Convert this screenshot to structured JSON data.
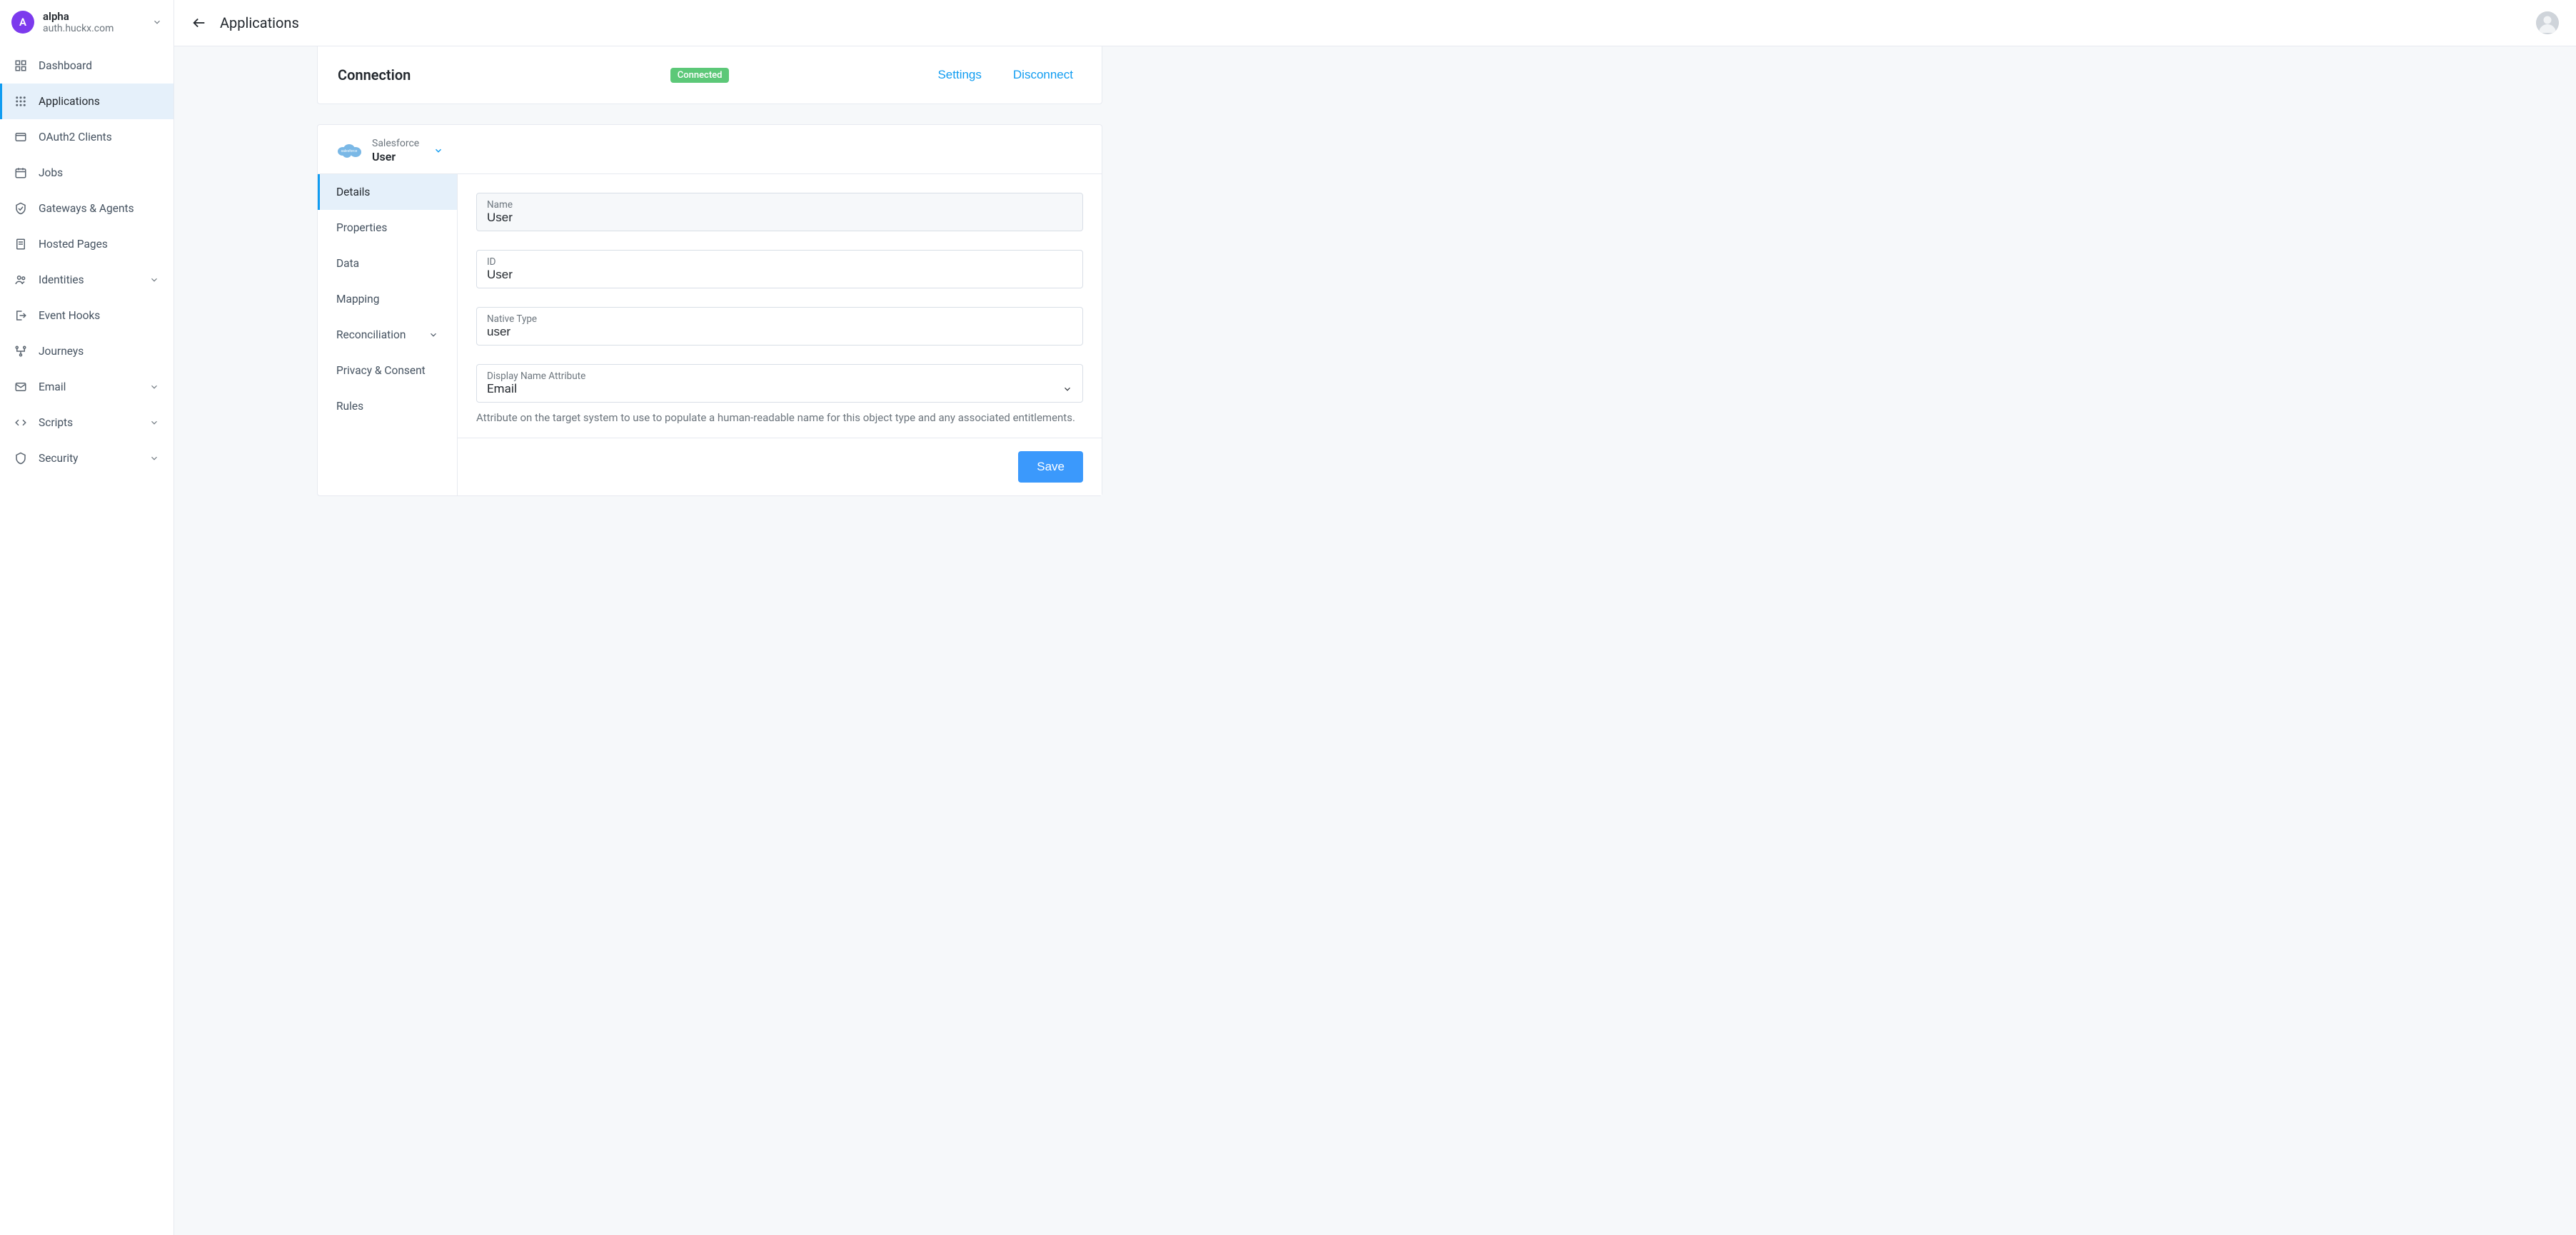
{
  "tenant": {
    "initial": "A",
    "name": "alpha",
    "domain": "auth.huckx.com"
  },
  "sidebar": {
    "items": [
      {
        "label": "Dashboard",
        "icon": "dashboard",
        "expandable": false,
        "active": false
      },
      {
        "label": "Applications",
        "icon": "apps",
        "expandable": false,
        "active": true
      },
      {
        "label": "OAuth2 Clients",
        "icon": "browser",
        "expandable": false,
        "active": false
      },
      {
        "label": "Jobs",
        "icon": "calendar",
        "expandable": false,
        "active": false
      },
      {
        "label": "Gateways & Agents",
        "icon": "shield-check",
        "expandable": false,
        "active": false
      },
      {
        "label": "Hosted Pages",
        "icon": "page",
        "expandable": false,
        "active": false
      },
      {
        "label": "Identities",
        "icon": "people",
        "expandable": true,
        "active": false
      },
      {
        "label": "Event Hooks",
        "icon": "exit",
        "expandable": false,
        "active": false
      },
      {
        "label": "Journeys",
        "icon": "route",
        "expandable": false,
        "active": false
      },
      {
        "label": "Email",
        "icon": "mail",
        "expandable": true,
        "active": false
      },
      {
        "label": "Scripts",
        "icon": "code",
        "expandable": true,
        "active": false
      },
      {
        "label": "Security",
        "icon": "shield",
        "expandable": true,
        "active": false
      }
    ]
  },
  "header": {
    "title": "Applications"
  },
  "connection": {
    "title": "Connection",
    "status": "Connected",
    "settings_label": "Settings",
    "disconnect_label": "Disconnect"
  },
  "object": {
    "provider": "Salesforce",
    "name": "User"
  },
  "tabs": [
    {
      "label": "Details",
      "expandable": false,
      "active": true
    },
    {
      "label": "Properties",
      "expandable": false,
      "active": false
    },
    {
      "label": "Data",
      "expandable": false,
      "active": false
    },
    {
      "label": "Mapping",
      "expandable": false,
      "active": false
    },
    {
      "label": "Reconciliation",
      "expandable": true,
      "active": false
    },
    {
      "label": "Privacy & Consent",
      "expandable": false,
      "active": false
    },
    {
      "label": "Rules",
      "expandable": false,
      "active": false
    }
  ],
  "form": {
    "name": {
      "label": "Name",
      "value": "User"
    },
    "id": {
      "label": "ID",
      "value": "User"
    },
    "native_type": {
      "label": "Native Type",
      "value": "user"
    },
    "display_name_attr": {
      "label": "Display Name Attribute",
      "value": "Email"
    },
    "display_name_help": "Attribute on the target system to use to populate a human-readable name for this object type and any associated entitlements."
  },
  "actions": {
    "save": "Save"
  }
}
